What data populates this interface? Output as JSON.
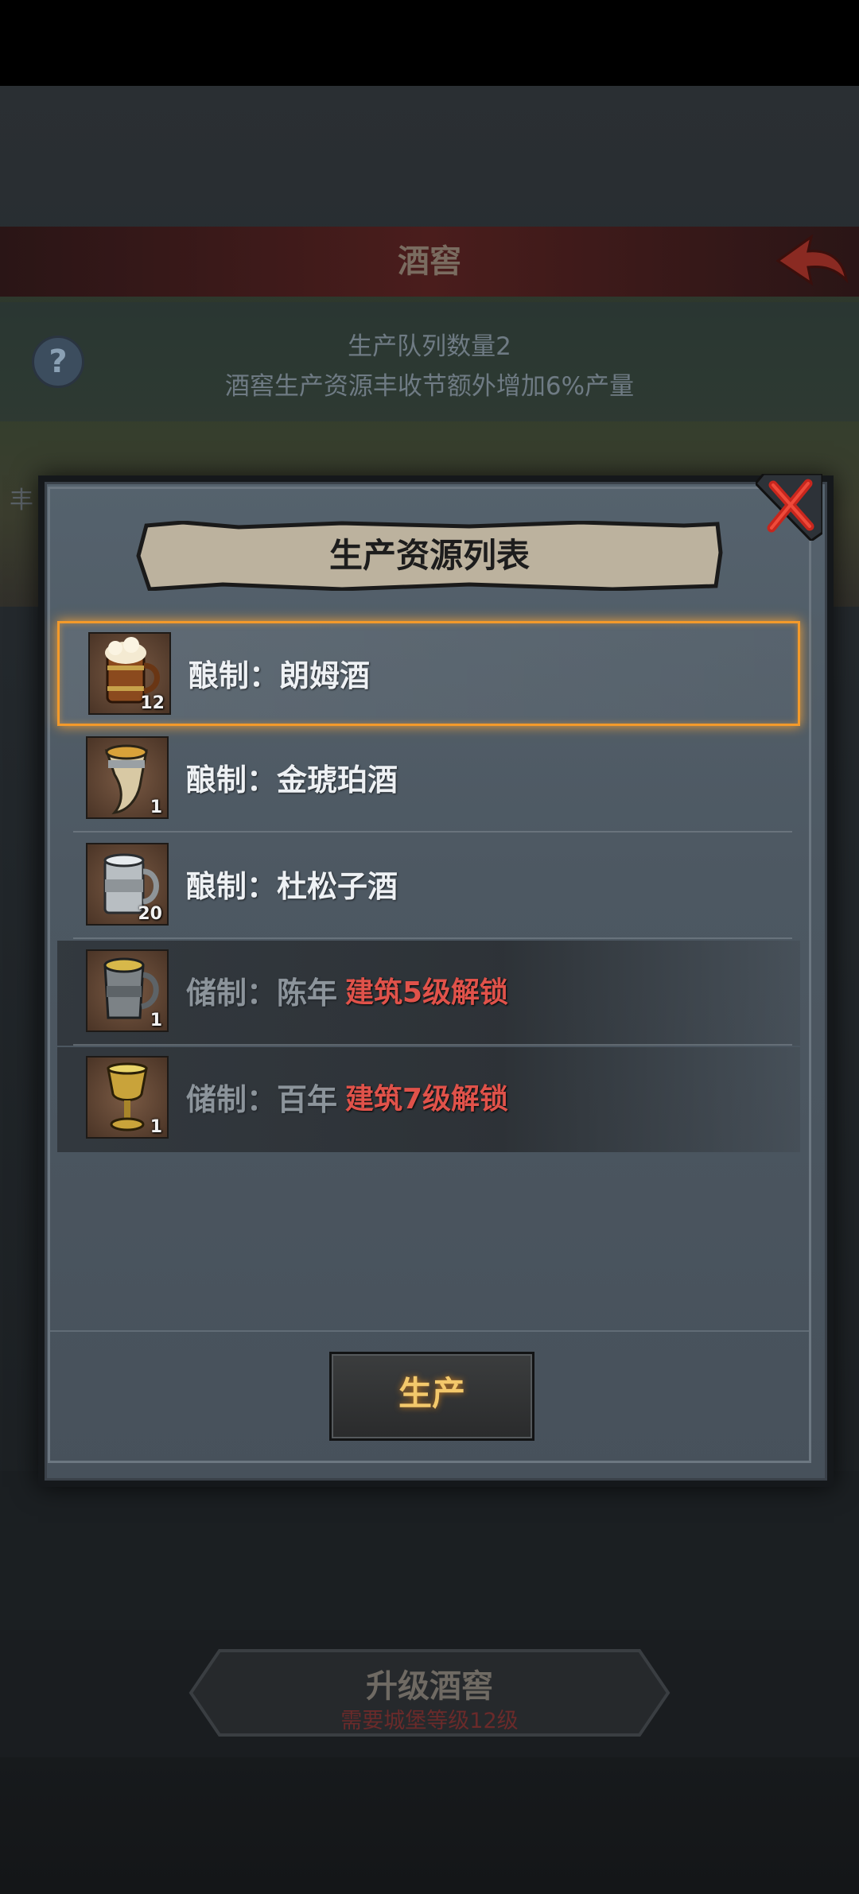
{
  "background": {
    "title": "酒窖",
    "info_line1": "生产队列数量2",
    "info_line2": "酒窖生产资源丰收节额外增加6%产量",
    "left_char": "丰",
    "help_glyph": "?",
    "upgrade_label": "升级酒窖",
    "upgrade_requirement": "需要城堡等级12级"
  },
  "modal": {
    "title": "生产资源列表",
    "produce_button": "生产",
    "items": [
      {
        "label": "酿制：朗姆酒",
        "qty": "12",
        "icon": "rum-barrel-mug-icon",
        "selected": true,
        "locked": false,
        "lock_note": ""
      },
      {
        "label": "酿制：金琥珀酒",
        "qty": "1",
        "icon": "amber-horn-icon",
        "selected": false,
        "locked": false,
        "lock_note": ""
      },
      {
        "label": "酿制：杜松子酒",
        "qty": "20",
        "icon": "pewter-tankard-icon",
        "selected": false,
        "locked": false,
        "lock_note": ""
      },
      {
        "label": "储制：陈年",
        "qty": "1",
        "icon": "aged-tankard-icon",
        "selected": false,
        "locked": true,
        "lock_note": "建筑5级解锁"
      },
      {
        "label": "储制：百年",
        "qty": "1",
        "icon": "golden-chalice-icon",
        "selected": false,
        "locked": true,
        "lock_note": "建筑7级解锁"
      }
    ]
  },
  "colors": {
    "selection": "#f39a2b",
    "lock_text": "#e0524a",
    "button_text": "#f3c86b"
  }
}
